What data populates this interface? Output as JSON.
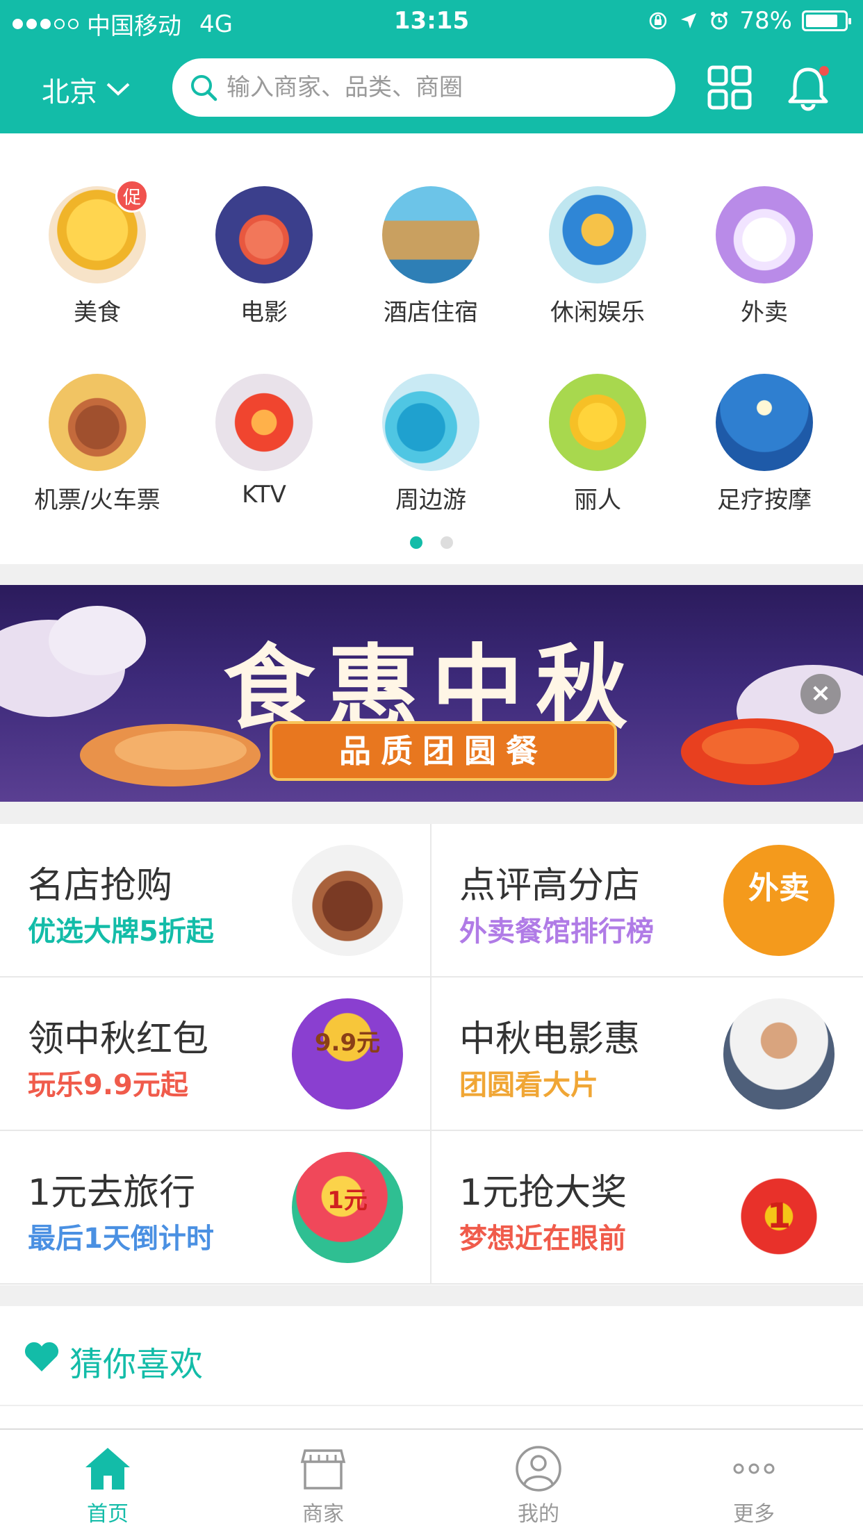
{
  "colors": {
    "accent": "#13bca8",
    "banner_bg": "#3d2a7a",
    "badge": "#f0524e"
  },
  "status_bar": {
    "carrier": "中国移动",
    "network": "4G",
    "time": "13:15",
    "battery": "78%",
    "icons": [
      "signal-dots-icon",
      "orientation-lock-icon",
      "location-arrow-icon",
      "alarm-icon",
      "battery-icon"
    ]
  },
  "header": {
    "city": "北京",
    "search_placeholder": "输入商家、品类、商圈",
    "icons": [
      "search-icon",
      "qr-scan-icon",
      "bell-icon"
    ]
  },
  "categories": [
    {
      "label": "美食",
      "badge": "促",
      "icon": "mooncake-icon"
    },
    {
      "label": "电影",
      "icon": "lotus-icon"
    },
    {
      "label": "酒店住宿",
      "icon": "tower-icon"
    },
    {
      "label": "休闲娱乐",
      "icon": "tea-cup-icon"
    },
    {
      "label": "外卖",
      "icon": "rabbit-icon"
    },
    {
      "label": "机票/火车票",
      "icon": "teapot-icon"
    },
    {
      "label": "KTV",
      "icon": "lantern-icon"
    },
    {
      "label": "周边游",
      "icon": "wave-icon"
    },
    {
      "label": "丽人",
      "icon": "flower-icon"
    },
    {
      "label": "足疗按摩",
      "icon": "moon-night-icon"
    }
  ],
  "pager": {
    "pages": 2,
    "active": 1
  },
  "banner": {
    "title": "食惠中秋",
    "subtitle": "品质团圆餐",
    "close": "×"
  },
  "promos": [
    {
      "title": "名店抢购",
      "subtitle": "优选大牌5折起",
      "subtitle_color": "#13bca8",
      "image": "steak-icon"
    },
    {
      "title": "点评高分店",
      "subtitle": "外卖餐馆排行榜",
      "subtitle_color": "#b07be6",
      "image": "takeout-badge-icon",
      "image_text": "外卖"
    },
    {
      "title": "领中秋红包",
      "subtitle": "玩乐9.9元起",
      "subtitle_color": "#f05b4b",
      "image": "red-packet-icon",
      "image_text": "9.9元"
    },
    {
      "title": "中秋电影惠",
      "subtitle": "团圆看大片",
      "subtitle_color": "#f0a635",
      "image": "actor-portrait-icon"
    },
    {
      "title": "1元去旅行",
      "subtitle": "最后1天倒计时",
      "subtitle_color": "#4a90e2",
      "image": "ticket-icon",
      "image_text": "1元"
    },
    {
      "title": "1元抢大奖",
      "subtitle": "梦想近在眼前",
      "subtitle_color": "#f05b4b",
      "image": "lucky-bag-icon",
      "image_text": "1"
    }
  ],
  "guess": {
    "label": "猜你喜欢"
  },
  "tabbar": [
    {
      "label": "首页",
      "icon": "home-icon",
      "active": true
    },
    {
      "label": "商家",
      "icon": "shop-icon",
      "active": false
    },
    {
      "label": "我的",
      "icon": "profile-icon",
      "active": false
    },
    {
      "label": "更多",
      "icon": "more-icon",
      "active": false
    }
  ]
}
